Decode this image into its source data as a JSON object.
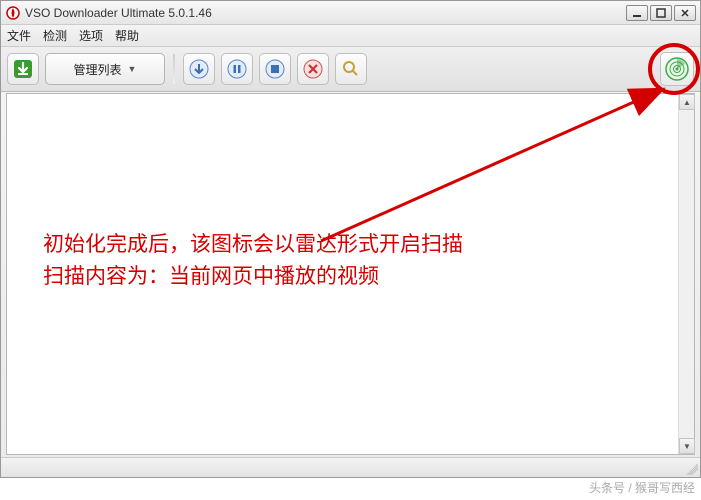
{
  "titlebar": {
    "title": "VSO Downloader Ultimate 5.0.1.46"
  },
  "menu": {
    "file": "文件",
    "detect": "检测",
    "options": "选项",
    "help": "帮助"
  },
  "toolbar": {
    "manage_label": "管理列表"
  },
  "icons": {
    "download": "download-icon",
    "play": "play-icon",
    "pause": "pause-icon",
    "stop": "stop-icon",
    "delete": "delete-icon",
    "search": "search-icon",
    "radar": "radar-icon"
  },
  "annotation": {
    "line1": "初始化完成后，该图标会以雷达形式开启扫描",
    "line2": "扫描内容为：当前网页中播放的视频"
  },
  "watermark": "头条号 / 猴哥写西经"
}
